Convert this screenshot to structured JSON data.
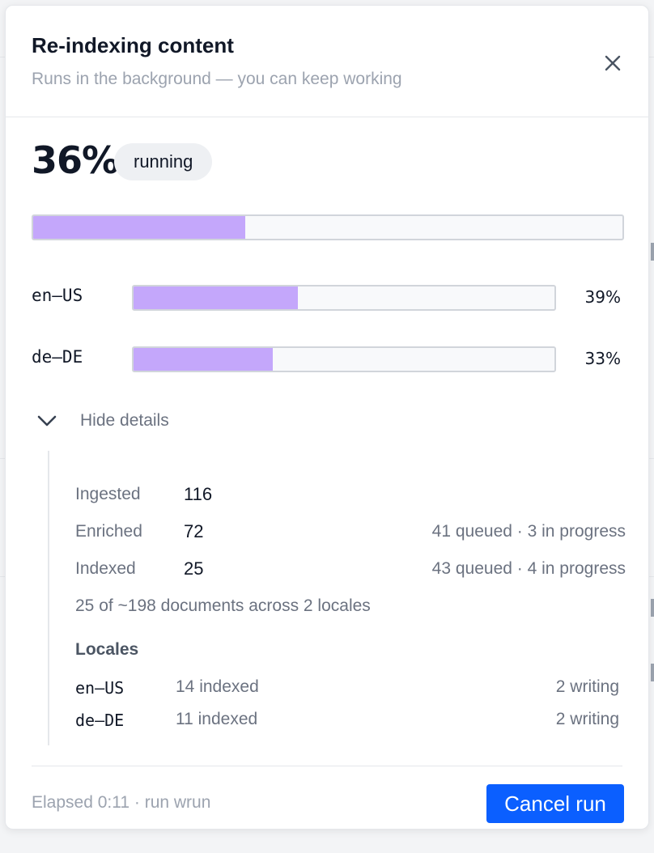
{
  "dialog": {
    "title": "Re-indexing content",
    "subtitle": "Runs in the background — you can keep working",
    "close_icon": "close-icon"
  },
  "progress": {
    "percent_label": "36%",
    "percent": 36,
    "status": "running",
    "fill_color": "#c4a7fb"
  },
  "locales": [
    {
      "code": "en–US",
      "percent_label": "39%",
      "percent": 39
    },
    {
      "code": "de–DE",
      "percent_label": "33%",
      "percent": 33
    }
  ],
  "details": {
    "toggle_label": "Hide details",
    "toggle_icon": "chevron-down-icon",
    "stats": [
      {
        "label": "Ingested",
        "value": "116",
        "extra": ""
      },
      {
        "label": "Enriched",
        "value": "72",
        "extra": "41 queued · 3 in progress"
      },
      {
        "label": "Indexed",
        "value": "25",
        "extra": "43 queued · 4 in progress"
      }
    ],
    "summary": "25 of ~198 documents across 2 locales",
    "locales_heading": "Locales",
    "locale_rows": [
      {
        "code": "en–US",
        "indexed": "14 indexed",
        "writing": "2 writing"
      },
      {
        "code": "de–DE",
        "indexed": "11 indexed",
        "writing": "2 writing"
      }
    ]
  },
  "footer": {
    "elapsed": "Elapsed 0:11 · run wrun",
    "cancel_label": "Cancel run",
    "accent_color": "#0b5fff"
  }
}
